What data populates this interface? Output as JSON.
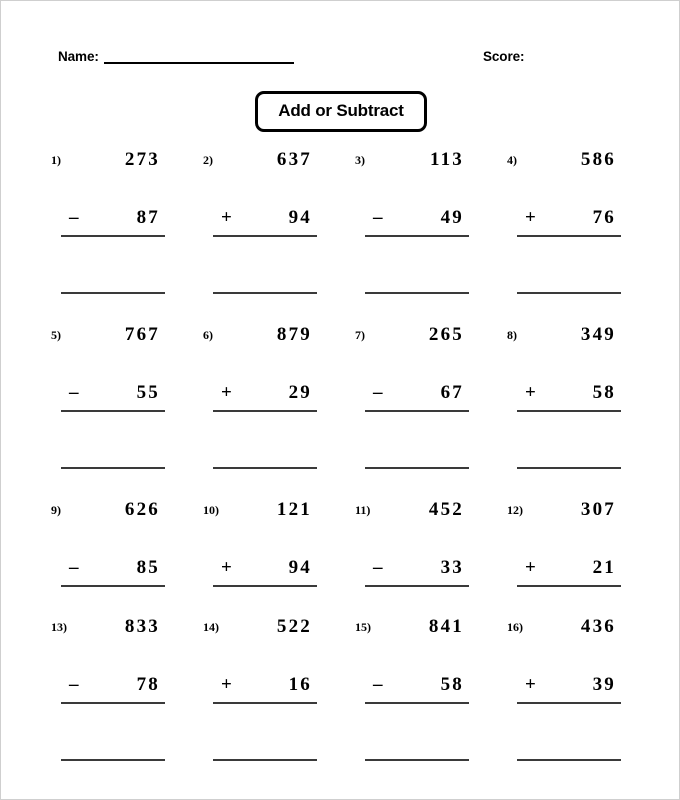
{
  "page": {
    "border_color": "#cfcfcf",
    "background": "#ffffff",
    "ink_color": "#000000",
    "rule_color": "#3a3a3a"
  },
  "header": {
    "name_label": "Name:",
    "score_label": "Score:"
  },
  "title": {
    "text": "Add or Subtract"
  },
  "problems": [
    {
      "index": "1)",
      "top": "273",
      "operator": "–",
      "bottom": "87",
      "answer_line": true
    },
    {
      "index": "2)",
      "top": "637",
      "operator": "+",
      "bottom": "94",
      "answer_line": true
    },
    {
      "index": "3)",
      "top": "113",
      "operator": "–",
      "bottom": "49",
      "answer_line": true
    },
    {
      "index": "4)",
      "top": "586",
      "operator": "+",
      "bottom": "76",
      "answer_line": true
    },
    {
      "index": "5)",
      "top": "767",
      "operator": "–",
      "bottom": "55",
      "answer_line": true
    },
    {
      "index": "6)",
      "top": "879",
      "operator": "+",
      "bottom": "29",
      "answer_line": true
    },
    {
      "index": "7)",
      "top": "265",
      "operator": "–",
      "bottom": "67",
      "answer_line": true
    },
    {
      "index": "8)",
      "top": "349",
      "operator": "+",
      "bottom": "58",
      "answer_line": true
    },
    {
      "index": "9)",
      "top": "626",
      "operator": "–",
      "bottom": "85",
      "answer_line": false
    },
    {
      "index": "10)",
      "top": "121",
      "operator": "+",
      "bottom": "94",
      "answer_line": false
    },
    {
      "index": "11)",
      "top": "452",
      "operator": "–",
      "bottom": "33",
      "answer_line": false
    },
    {
      "index": "12)",
      "top": "307",
      "operator": "+",
      "bottom": "21",
      "answer_line": false
    },
    {
      "index": "13)",
      "top": "833",
      "operator": "–",
      "bottom": "78",
      "answer_line": true
    },
    {
      "index": "14)",
      "top": "522",
      "operator": "+",
      "bottom": "16",
      "answer_line": true
    },
    {
      "index": "15)",
      "top": "841",
      "operator": "–",
      "bottom": "58",
      "answer_line": true
    },
    {
      "index": "16)",
      "top": "436",
      "operator": "+",
      "bottom": "39",
      "answer_line": true
    }
  ]
}
